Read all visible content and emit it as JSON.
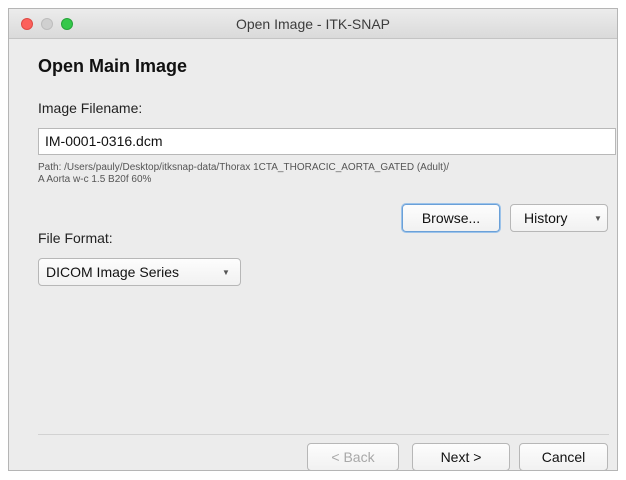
{
  "window": {
    "title": "Open Image - ITK-SNAP"
  },
  "page": {
    "heading": "Open Main Image"
  },
  "filename": {
    "label": "Image Filename:",
    "value": "IM-0001-0316.dcm",
    "path_line1": "Path: /Users/pauly/Desktop/itksnap-data/Thorax 1CTA_THORACIC_AORTA_GATED (Adult)/",
    "path_line2": "A Aorta w-c  1.5  B20f  60%"
  },
  "buttons": {
    "browse": "Browse...",
    "history": "History",
    "back": "< Back",
    "next": "Next >",
    "cancel": "Cancel"
  },
  "format": {
    "label": "File Format:",
    "selected": "DICOM Image Series"
  },
  "icons": {
    "dropdown": "chevron-down-icon"
  }
}
